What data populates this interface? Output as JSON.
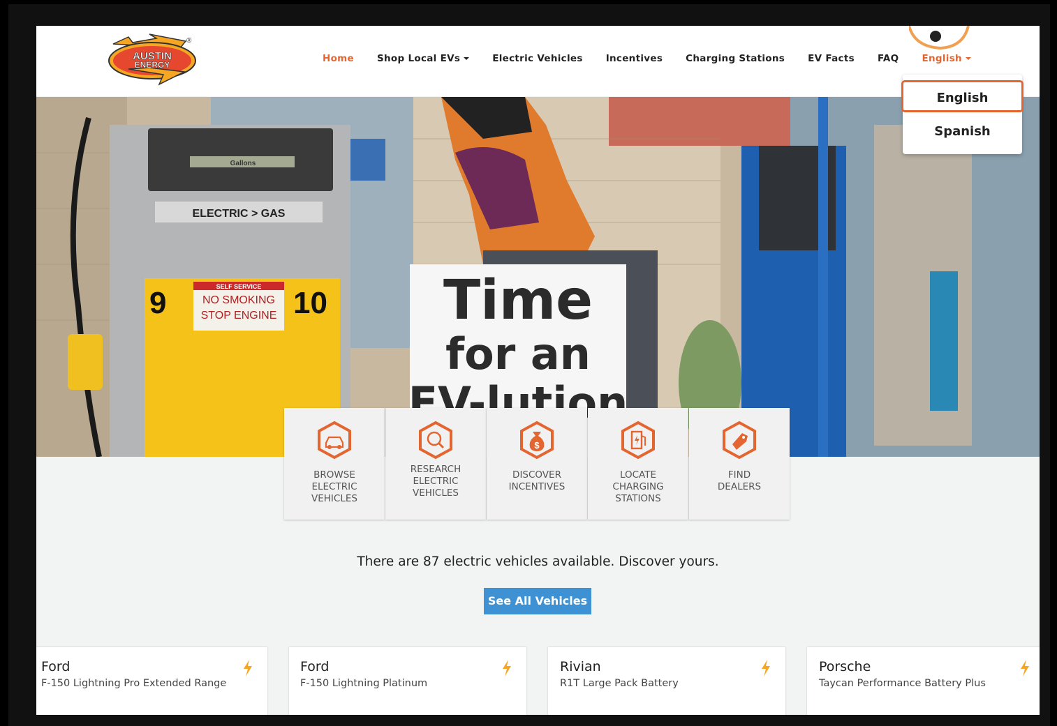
{
  "brand": {
    "logo_text_line1": "AUSTIN",
    "logo_text_line2": "ENERGY",
    "logo_registered": "®"
  },
  "nav": {
    "items": [
      {
        "label": "Home",
        "active": true
      },
      {
        "label": "Shop Local EVs",
        "has_caret": true
      },
      {
        "label": "Electric Vehicles"
      },
      {
        "label": "Incentives"
      },
      {
        "label": "Charging Stations"
      },
      {
        "label": "EV Facts"
      },
      {
        "label": "FAQ"
      }
    ],
    "language_toggle": "English"
  },
  "language_dropdown": {
    "options": [
      "English",
      "Spanish"
    ],
    "selected": "English"
  },
  "hero": {
    "pump_number_left": "9",
    "pump_number_right": "10",
    "pump_display": "Gallons",
    "pump_label": "ELECTRIC > GAS",
    "pump_sign_header": "SELF SERVICE",
    "pump_sign_line1": "NO SMOKING",
    "pump_sign_line2": "STOP ENGINE",
    "sign_line1": "Time",
    "sign_line2": "for an",
    "sign_line3": "EV-lution"
  },
  "tiles": [
    {
      "label": "BROWSE\nELECTRIC\nVEHICLES",
      "icon": "car-icon"
    },
    {
      "label": "RESEARCH\nELECTRIC\nVEHICLES",
      "icon": "magnifier-icon"
    },
    {
      "label": "DISCOVER\nINCENTIVES",
      "icon": "money-bag-icon"
    },
    {
      "label": "LOCATE\nCHARGING\nSTATIONS",
      "icon": "charging-station-icon"
    },
    {
      "label": "FIND\nDEALERS",
      "icon": "dealer-tag-icon"
    }
  ],
  "vehicle_count_text": "There are 87 electric vehicles available. Discover yours.",
  "see_all_label": "See All Vehicles",
  "vehicles": [
    {
      "make": "Ford",
      "model": "F-150 Lightning Pro Extended Range"
    },
    {
      "make": "Ford",
      "model": "F-150 Lightning Platinum"
    },
    {
      "make": "Rivian",
      "model": "R1T Large Pack Battery"
    },
    {
      "make": "Porsche",
      "model": "Taycan Performance Battery Plus"
    }
  ],
  "colors": {
    "accent": "#e3652f",
    "button": "#3e92d3",
    "bolt": "#f5a623"
  }
}
